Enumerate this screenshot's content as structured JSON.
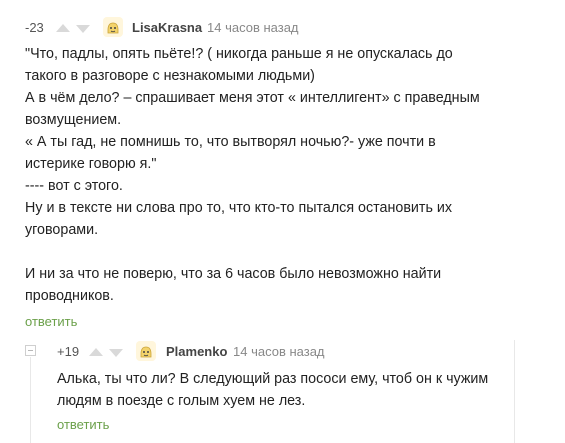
{
  "comment1": {
    "rating": "-23",
    "author": "LisaKrasna",
    "time": "14 часов назад",
    "lines": [
      "\"Что, падлы, опять пьёте!? ( никогда раньше я не опускалась до",
      "такого в разговоре с незнакомыми людьми)",
      "А в чём дело? – спрашивает меня этот « интеллигент» с праведным",
      "возмущением.",
      "« А ты гад, не помнишь то, что вытворял ночью?- уже почти в",
      "истерике говорю я.\"",
      "---- вот с этого.",
      "Ну и в тексте ни слова про то, что кто-то пытался остановить их",
      "уговорами.",
      "",
      "И ни за что не поверю, что за 6 часов было невозможно найти",
      "проводников."
    ],
    "reply_label": "ответить"
  },
  "comment2": {
    "rating": "+19",
    "author": "Plamenko",
    "time": "14 часов назад",
    "lines": [
      "Алька, ты что ли? В следующий раз пососи ему, чтоб он к чужим",
      "людям в поезде с голым хуем не лез."
    ],
    "reply_label": "ответить"
  },
  "colors": {
    "reply": "#6ba04a",
    "vote_arrow": "#d9d9d9",
    "thread_line": "#e8e8e8"
  }
}
